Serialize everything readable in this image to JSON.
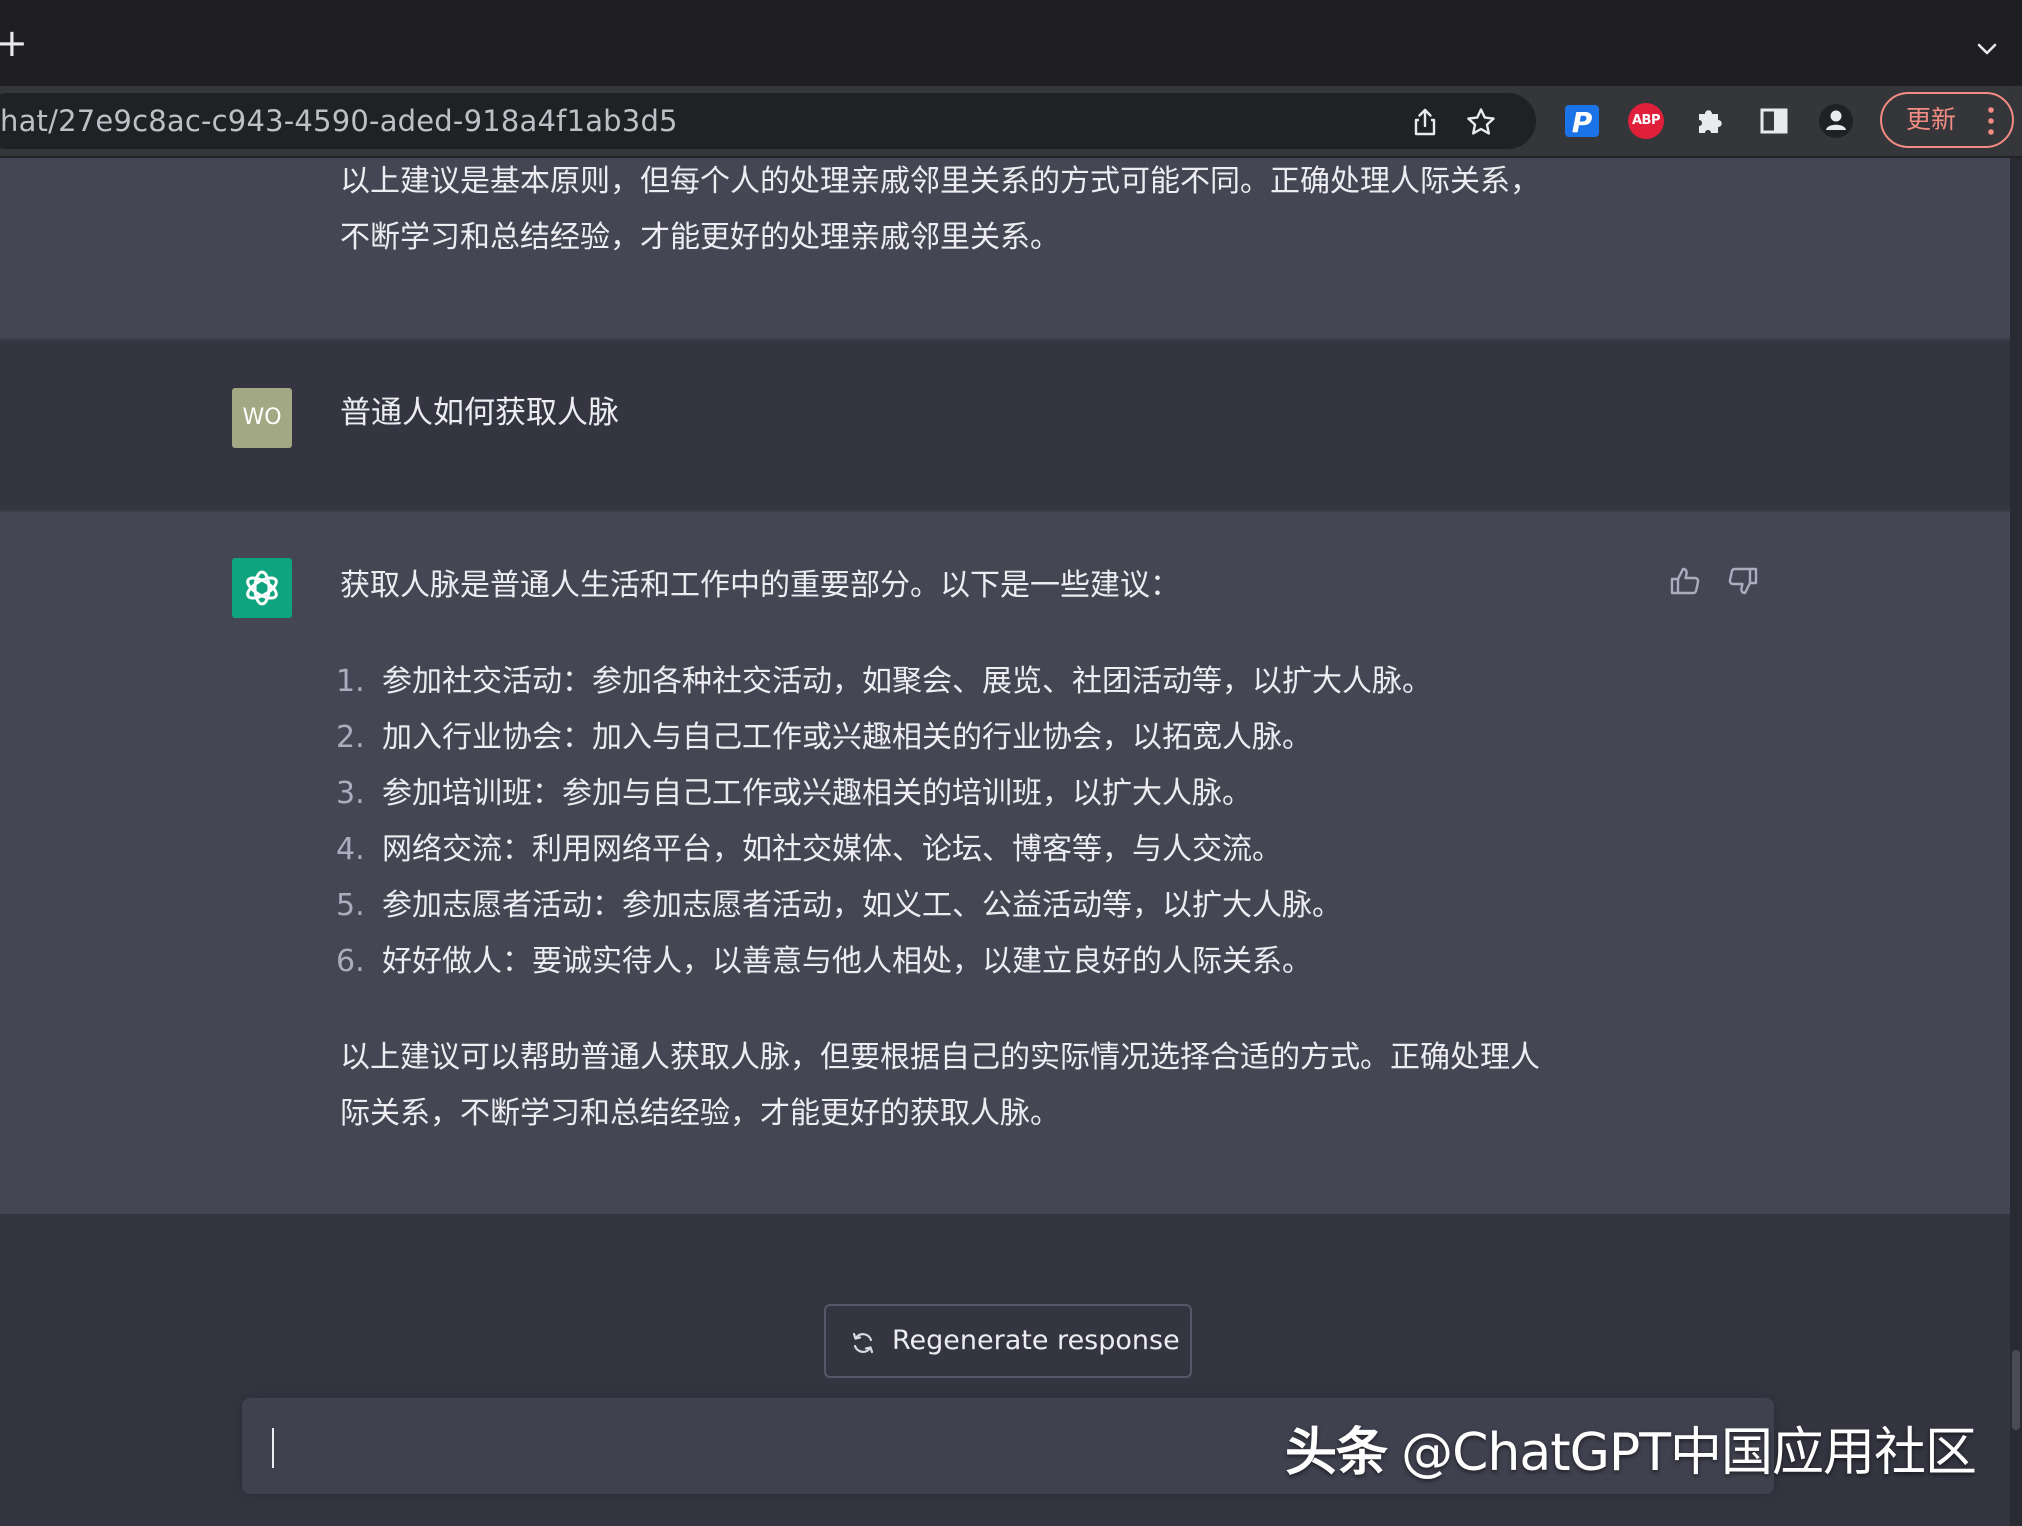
{
  "browser": {
    "new_tab_symbol": "+",
    "url": "hat/27e9c8ac-c943-4590-aded-918a4f1ab3d5",
    "extensions": {
      "p_label": "P",
      "abp_label": "ABP"
    },
    "update_label": "更新",
    "icons": [
      "share-icon",
      "star-icon",
      "puzzle-icon",
      "sidepanel-icon",
      "profile-icon",
      "menu-dots-icon",
      "tab-search-chevron-icon"
    ]
  },
  "conversation": {
    "previous_answer_tail": [
      "以上建议是基本原则，但每个人的处理亲戚邻里关系的方式可能不同。正确处理人际关系，",
      "不断学习和总结经验，才能更好的处理亲戚邻里关系。"
    ],
    "user": {
      "avatar": "WO",
      "message": "普通人如何获取人脉"
    },
    "assistant": {
      "intro": "获取人脉是普通人生活和工作中的重要部分。以下是一些建议：",
      "items": [
        {
          "num": "1.",
          "text": "参加社交活动：参加各种社交活动，如聚会、展览、社团活动等，以扩大人脉。"
        },
        {
          "num": "2.",
          "text": "加入行业协会：加入与自己工作或兴趣相关的行业协会，以拓宽人脉。"
        },
        {
          "num": "3.",
          "text": "参加培训班：参加与自己工作或兴趣相关的培训班，以扩大人脉。"
        },
        {
          "num": "4.",
          "text": "网络交流：利用网络平台，如社交媒体、论坛、博客等，与人交流。"
        },
        {
          "num": "5.",
          "text": "参加志愿者活动：参加志愿者活动，如义工、公益活动等，以扩大人脉。"
        },
        {
          "num": "6.",
          "text": "好好做人：要诚实待人，以善意与他人相处，以建立良好的人际关系。"
        }
      ],
      "summary": [
        "以上建议可以帮助普通人获取人脉，但要根据自己的实际情况选择合适的方式。正确处理人",
        "际关系，不断学习和总结经验，才能更好的获取人脉。"
      ]
    }
  },
  "input": {
    "regenerate_label": "Regenerate response"
  },
  "watermark": {
    "brand": "头条",
    "handle": "@ChatGPT中国应用社区"
  },
  "colors": {
    "page_bg": "#343541",
    "assistant_bg": "#444654",
    "user_avatar": "#a3a884",
    "bot_avatar": "#10a37f",
    "update_accent": "#f28b82"
  }
}
